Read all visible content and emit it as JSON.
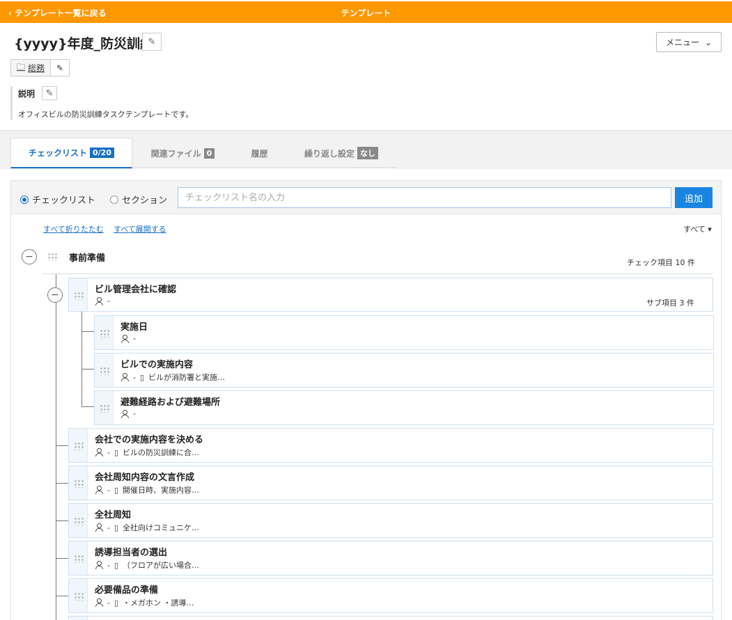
{
  "header": {
    "back_label": "テンプレート一覧に戻る",
    "center_title": "テンプレート"
  },
  "template": {
    "title": "{yyyy}年度_防災訓練",
    "category": "総務",
    "description_label": "説明",
    "description": "オフィスビルの防災訓練タスクテンプレートです。"
  },
  "menu_label": "メニュー",
  "tabs": [
    {
      "label": "チェックリスト",
      "badge": "0/20"
    },
    {
      "label": "関連ファイル",
      "badge": "0"
    },
    {
      "label": "履歴",
      "badge": ""
    },
    {
      "label": "繰り返し設定",
      "badge": "なし"
    }
  ],
  "add_bar": {
    "radio_checklist": "チェックリスト",
    "radio_section": "セクション",
    "placeholder": "チェックリスト名の入力",
    "add_label": "追加"
  },
  "controls": {
    "collapse_all": "すべて折りたたむ",
    "expand_all": "すべて展開する",
    "filter": "すべて"
  },
  "section": {
    "name": "事前準備",
    "count": "チェック項目 10 件"
  },
  "items": [
    {
      "name": "ビル管理会社に確認",
      "assignee": "-",
      "note": "",
      "right": "サブ項目 3 件"
    },
    {
      "name": "実施日",
      "assignee": "-",
      "note": "",
      "right": ""
    },
    {
      "name": "ビルでの実施内容",
      "assignee": "-",
      "note": "ビルが消防署と実施…",
      "right": ""
    },
    {
      "name": "避難経路および避難場所",
      "assignee": "-",
      "note": "",
      "right": ""
    },
    {
      "name": "会社での実施内容を決める",
      "assignee": "-",
      "note": "ビルの防災訓練に合…",
      "right": ""
    },
    {
      "name": "会社周知内容の文言作成",
      "assignee": "-",
      "note": "開催日時、実施内容…",
      "right": ""
    },
    {
      "name": "全社周知",
      "assignee": "-",
      "note": "全社向けコミュニケ…",
      "right": ""
    },
    {
      "name": "誘導担当者の選出",
      "assignee": "-",
      "note": "（フロアが広い場合…",
      "right": ""
    },
    {
      "name": "必要備品の準備",
      "assignee": "-",
      "note": "・メガホン ・誘導…",
      "right": ""
    }
  ]
}
